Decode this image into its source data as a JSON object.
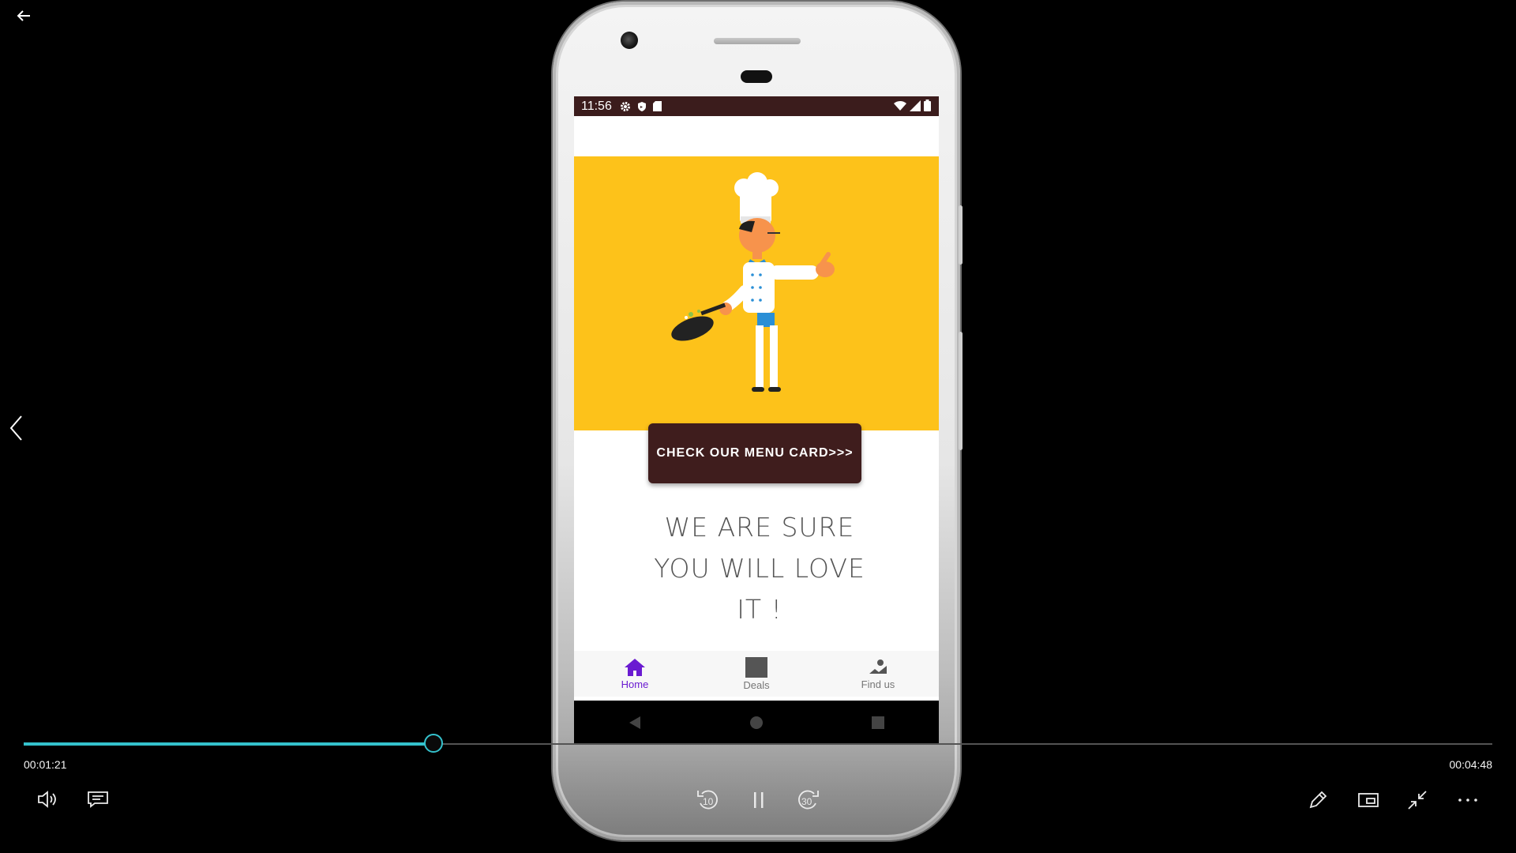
{
  "player": {
    "elapsed": "00:01:21",
    "duration": "00:04:48",
    "progress_fraction": 0.279,
    "skip_back_seconds": "10",
    "skip_forward_seconds": "30",
    "accent_color": "#35c4cf"
  },
  "phone": {
    "status_bar": {
      "time": "11:56",
      "left_icons": [
        "gear-icon",
        "shield-icon",
        "sd-card-icon"
      ],
      "right_icons": [
        "wifi-icon",
        "signal-icon",
        "battery-icon"
      ],
      "background": "#3b1c1c"
    },
    "app": {
      "hero_background": "#fdc21a",
      "menu_button_label": "CHECK OUR MENU CARD>>>",
      "tagline_lines": [
        "WE ARE SURE",
        "YOU WILL LOVE",
        "IT !"
      ],
      "bottom_nav": [
        {
          "label": "Home",
          "icon": "home-icon",
          "active": true
        },
        {
          "label": "Deals",
          "icon": "deals-icon",
          "active": false
        },
        {
          "label": "Find us",
          "icon": "map-icon",
          "active": false
        }
      ],
      "active_color": "#6a1bd1"
    }
  }
}
